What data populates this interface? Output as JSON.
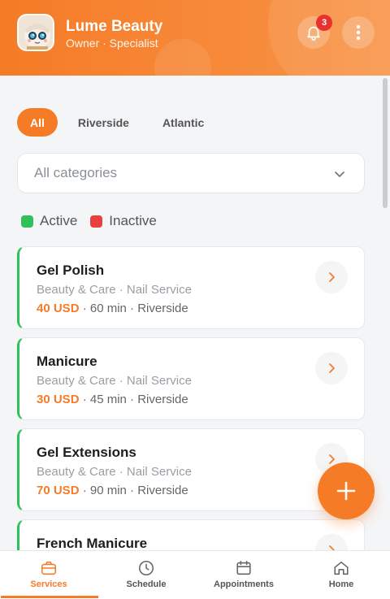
{
  "header": {
    "name": "Lume Beauty",
    "role": "Owner · Specialist",
    "notifications_count": "3",
    "icons": {
      "avatar": "avatar-icon",
      "bell": "bell-icon",
      "more": "more-vertical-icon"
    }
  },
  "tabs": [
    {
      "label": "All",
      "active": true
    },
    {
      "label": "Riverside",
      "active": false
    },
    {
      "label": "Atlantic",
      "active": false
    }
  ],
  "category_filter": {
    "value": "All categories"
  },
  "legend": [
    {
      "label": "Active",
      "color": "#2fbf5b"
    },
    {
      "label": "Inactive",
      "color": "#e8403f"
    }
  ],
  "services": [
    {
      "name": "Gel Polish",
      "category": "Beauty & Care · Nail Service",
      "price": "40 USD",
      "details": " · 60 min · Riverside"
    },
    {
      "name": "Manicure",
      "category": "Beauty & Care · Nail Service",
      "price": "30 USD",
      "details": " · 45 min · Riverside"
    },
    {
      "name": "Gel Extensions",
      "category": "Beauty & Care · Nail Service",
      "price": "70 USD",
      "details": " · 90 min · Riverside"
    },
    {
      "name": "French Manicure",
      "category": "",
      "price": "",
      "details": ""
    }
  ],
  "bottom_nav": [
    {
      "label": "Services",
      "icon": "briefcase-icon",
      "active": true
    },
    {
      "label": "Schedule",
      "icon": "clock-icon",
      "active": false
    },
    {
      "label": "Appointments",
      "icon": "calendar-icon",
      "active": false
    },
    {
      "label": "Home",
      "icon": "home-icon",
      "active": false
    }
  ],
  "colors": {
    "accent": "#f57b26",
    "active": "#2fbf5b",
    "inactive": "#e8403f"
  }
}
